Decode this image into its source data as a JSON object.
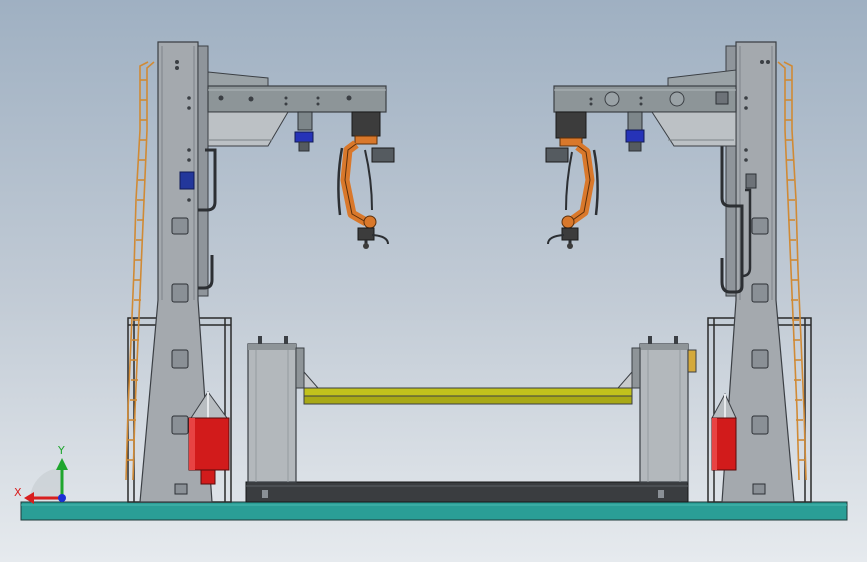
{
  "view": {
    "background_top": "#9fb0c2",
    "background_bottom": "#e6eaee"
  },
  "triad": {
    "x_label": "X",
    "y_label": "Y",
    "x_color": "#d81e1e",
    "y_color": "#1fa62e",
    "z_color": "#1c2fd6"
  },
  "palette": {
    "steel": "#a4a9ae",
    "steel_dark": "#6d7278",
    "beam": "#8d9598",
    "robot_orange": "#d9782b",
    "robot_dark": "#3c3c3c",
    "torch_blue": "#2633b8",
    "cylinder_red": "#d21b1b",
    "fixture_yellow": "#c2c21c",
    "floor_teal": "#2a9e96",
    "ladder_orange": "#d08a35",
    "box_blue": "#23379b"
  }
}
